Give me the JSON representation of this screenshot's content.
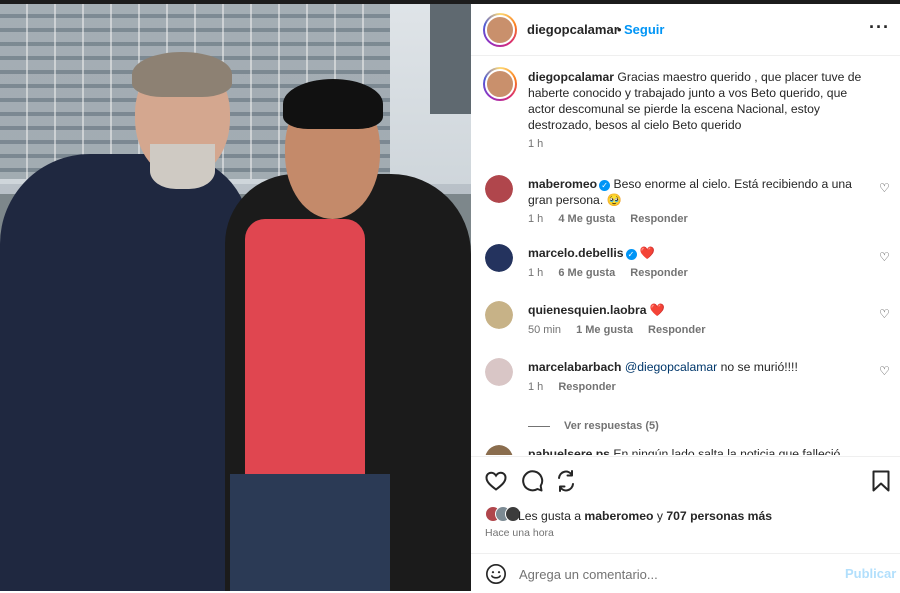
{
  "post": {
    "username": "diegopcalamar",
    "separator": "•",
    "follow_label": "Seguir",
    "more_label": "···",
    "caption_text": "Gracias maestro querido , que placer tuve de haberte conocido y trabajado junto a vos Beto querido, que actor descomunal se pierde la escena Nacional, estoy destrozado, besos al cielo Beto querido",
    "caption_time": "1 h"
  },
  "comments": [
    {
      "username": "maberomeo",
      "verified": true,
      "text": "Beso enorme al cielo. Está recibiendo a una gran persona. 🥹",
      "time": "1 h",
      "likes": "4 Me gusta",
      "reply": "Responder"
    },
    {
      "username": "marcelo.debellis",
      "verified": true,
      "text": "❤️",
      "time": "1 h",
      "likes": "6 Me gusta",
      "reply": "Responder"
    },
    {
      "username": "quienesquien.laobra",
      "verified": false,
      "text": "❤️",
      "time": "50 min",
      "likes": "1 Me gusta",
      "reply": "Responder"
    },
    {
      "username": "marcelabarbach",
      "verified": false,
      "mention": "@diegopcalamar",
      "text": "no se murió!!!!",
      "time": "1 h",
      "reply": "Responder"
    },
    {
      "username": "pabuelsere.ps",
      "verified": false,
      "text": "En ningún lado salta la noticia que falleció"
    }
  ],
  "view_replies": "Ver respuestas (5)",
  "likes": {
    "prefix": "Les gusta a",
    "first": "maberomeo",
    "middle": "y",
    "rest": "707 personas más"
  },
  "timestamp": "Hace una hora",
  "add_comment": {
    "placeholder": "Agrega un comentario...",
    "post_label": "Publicar"
  },
  "icons": {
    "like": "heart-icon",
    "comment": "comment-icon",
    "share": "share-icon",
    "save": "bookmark-icon",
    "emoji": "emoji-icon"
  },
  "colors": {
    "link_blue": "#0095f6",
    "muted": "#737373",
    "text": "#262626"
  }
}
